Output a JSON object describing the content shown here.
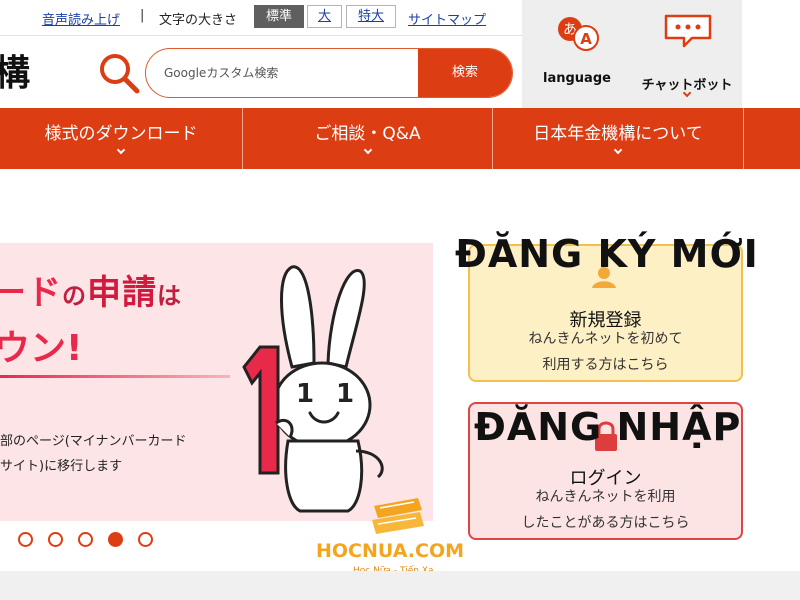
{
  "utility": {
    "read_aloud": "音声読み上げ",
    "separator": "|",
    "font_size_label": "文字の大きさ",
    "font_sizes": [
      "標準",
      "大",
      "特大"
    ],
    "sitemap": "サイトマップ"
  },
  "header": {
    "logo_fragment": "構",
    "search_placeholder": "Googleカスタム検索",
    "search_button": "検索",
    "language_label": "language",
    "chatbot_label": "チャットボット"
  },
  "nav": {
    "items": [
      "様式のダウンロード",
      "ご相談・Q&A",
      "日本年金機構について"
    ]
  },
  "banner": {
    "head_part1": "ード",
    "head_part2": "の",
    "head_part3": "申請",
    "head_part4": "は",
    "head_line2": "ウン!",
    "body_line1": "部のページ(マイナンバーカード",
    "body_line2": "サイト)に移行します"
  },
  "carousel": {
    "count": 5,
    "active_index": 3
  },
  "cards": {
    "new": {
      "overlay": "ĐĂNG KÝ MỚI",
      "title": "新規登録",
      "desc_line1": "ねんきんネットを初めて",
      "desc_line2": "利用する方はこちら"
    },
    "login": {
      "overlay": "ĐĂNG NHẬP",
      "title": "ログイン",
      "desc_line1": "ねんきんネットを利用",
      "desc_line2": "したことがある方はこちら"
    }
  },
  "watermark": {
    "brand": "HOCNUA.COM",
    "tagline": "Học Nữa - Tiến Xa"
  },
  "colors": {
    "accent": "#dd3d12",
    "card_new_bg": "#fdf0c5",
    "card_login_bg": "#fde4e4"
  }
}
